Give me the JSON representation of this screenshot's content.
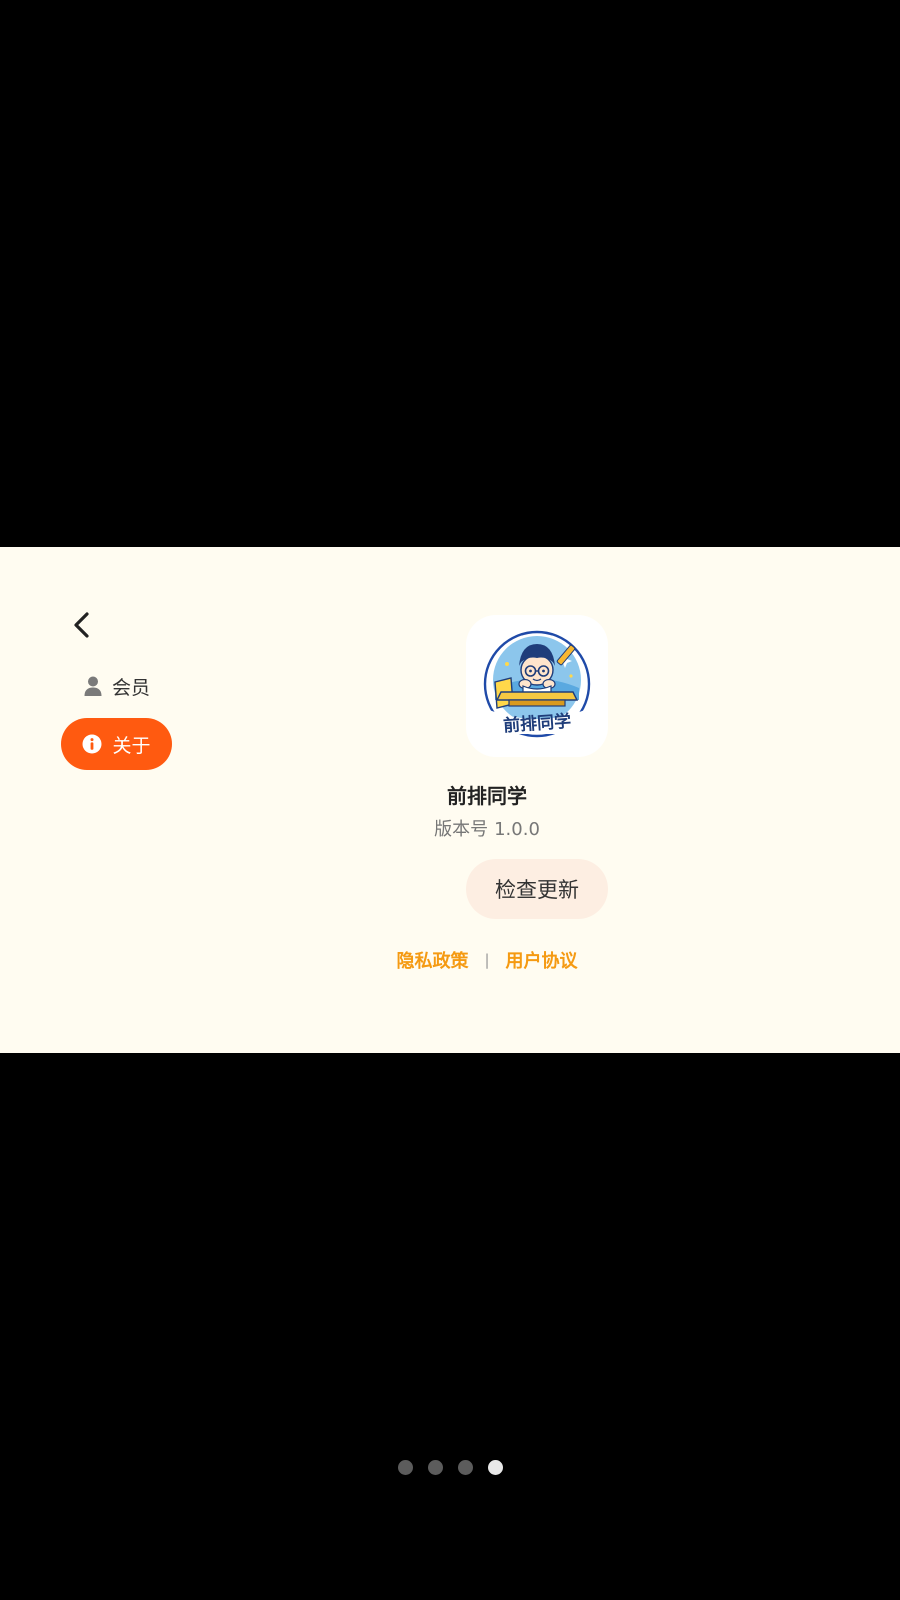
{
  "sidebar": {
    "items": [
      {
        "label": "会员",
        "icon": "person-icon"
      },
      {
        "label": "关于",
        "icon": "info-icon",
        "active": true
      }
    ]
  },
  "about": {
    "logo_text": "前排同学",
    "app_name": "前排同学",
    "version_label": "版本号",
    "version_value": "1.0.0",
    "check_update_label": "检查更新",
    "privacy_link": "隐私政策",
    "separator": "|",
    "terms_link": "用户协议"
  },
  "pager": {
    "total": 4,
    "current": 4
  },
  "colors": {
    "accent": "#ff5a10",
    "link": "#f59a12",
    "panel_bg": "#fffcf1",
    "button_bg": "#fdeee2"
  }
}
